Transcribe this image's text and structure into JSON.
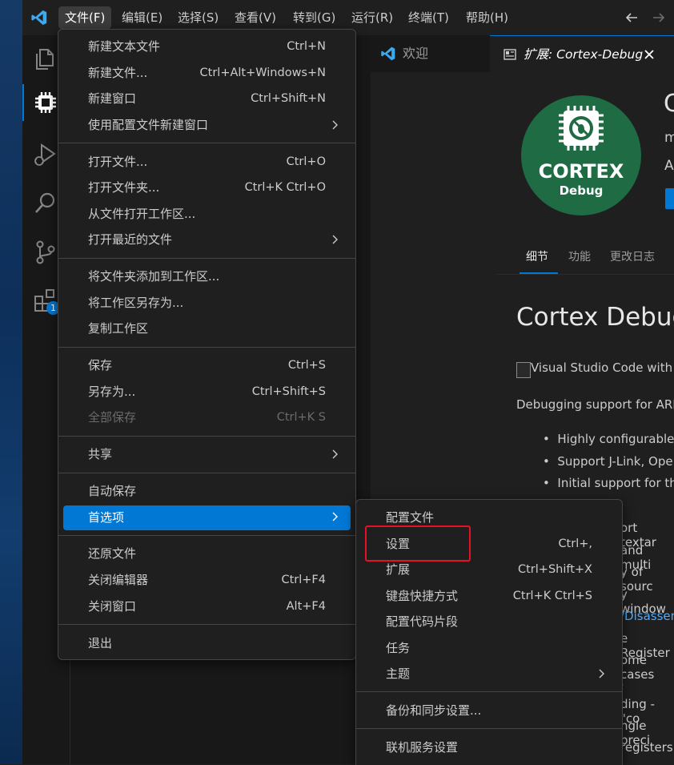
{
  "menubar": {
    "items": [
      "文件(F)",
      "编辑(E)",
      "选择(S)",
      "查看(V)",
      "转到(G)",
      "运行(R)",
      "终端(T)",
      "帮助(H)"
    ]
  },
  "activity": {
    "extensions_badge": "1"
  },
  "tabs": {
    "welcome": "欢迎",
    "extension_prefix": "扩展: ",
    "extension_name": "Cortex-Debug"
  },
  "extension": {
    "logo_text_main": "CORTEX",
    "logo_text_sub": "Debug",
    "title_partial": "C",
    "publisher_partial": "m",
    "desc_partial": "A",
    "detail_tabs": [
      "细节",
      "功能",
      "更改日志"
    ],
    "readme_title": "Cortex Debug",
    "image_alt": "Visual Studio Code with C",
    "intro": "Debugging support for ARM",
    "bullets": [
      "Highly configurable.",
      "Support J-Link, Open",
      "Initial support for the"
    ],
    "tail_lines": [
      "ort textar",
      "and multi",
      "y of sourc",
      "y window",
      "/Disassen",
      "e Register",
      "ome cases",
      ".",
      "ding - \"co",
      "ngle preci",
      "registers"
    ]
  },
  "file_menu": {
    "items": [
      {
        "label": "新建文本文件",
        "shortcut": "Ctrl+N"
      },
      {
        "label": "新建文件...",
        "shortcut": "Ctrl+Alt+Windows+N"
      },
      {
        "label": "新建窗口",
        "shortcut": "Ctrl+Shift+N"
      },
      {
        "label": "使用配置文件新建窗口",
        "shortcut": ""
      },
      {
        "label": "打开文件...",
        "shortcut": "Ctrl+O"
      },
      {
        "label": "打开文件夹...",
        "shortcut": "Ctrl+K Ctrl+O"
      },
      {
        "label": "从文件打开工作区...",
        "shortcut": ""
      },
      {
        "label": "打开最近的文件",
        "shortcut": ""
      },
      {
        "label": "将文件夹添加到工作区...",
        "shortcut": ""
      },
      {
        "label": "将工作区另存为...",
        "shortcut": ""
      },
      {
        "label": "复制工作区",
        "shortcut": ""
      },
      {
        "label": "保存",
        "shortcut": "Ctrl+S"
      },
      {
        "label": "另存为...",
        "shortcut": "Ctrl+Shift+S"
      },
      {
        "label": "全部保存",
        "shortcut": "Ctrl+K S"
      },
      {
        "label": "共享",
        "shortcut": ""
      },
      {
        "label": "自动保存",
        "shortcut": ""
      },
      {
        "label": "首选项",
        "shortcut": ""
      },
      {
        "label": "还原文件",
        "shortcut": ""
      },
      {
        "label": "关闭编辑器",
        "shortcut": "Ctrl+F4"
      },
      {
        "label": "关闭窗口",
        "shortcut": "Alt+F4"
      },
      {
        "label": "退出",
        "shortcut": ""
      }
    ]
  },
  "pref_menu": {
    "items": [
      {
        "label": "配置文件",
        "shortcut": ""
      },
      {
        "label": "设置",
        "shortcut": "Ctrl+,"
      },
      {
        "label": "扩展",
        "shortcut": "Ctrl+Shift+X"
      },
      {
        "label": "键盘快捷方式",
        "shortcut": "Ctrl+K Ctrl+S"
      },
      {
        "label": "配置代码片段",
        "shortcut": ""
      },
      {
        "label": "任务",
        "shortcut": ""
      },
      {
        "label": "主题",
        "shortcut": ""
      },
      {
        "label": "备份和同步设置...",
        "shortcut": ""
      },
      {
        "label": "联机服务设置",
        "shortcut": ""
      }
    ]
  },
  "colors": {
    "accent": "#0078d4",
    "highlight_box": "#e81123",
    "logo_bg": "#1e6b44"
  }
}
